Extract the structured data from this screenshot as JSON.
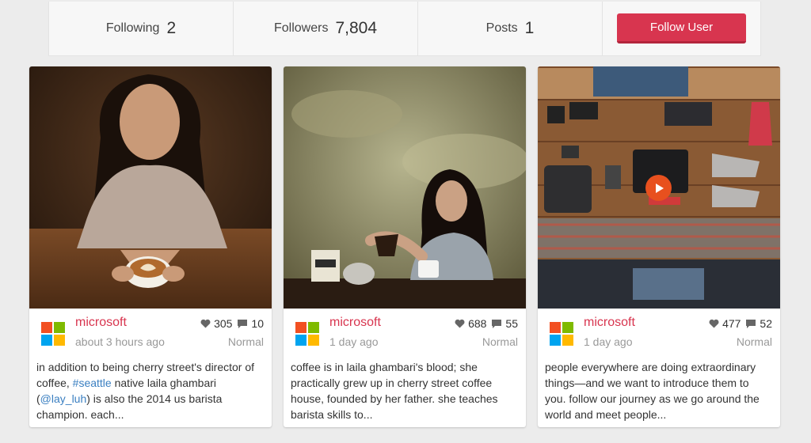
{
  "stats": {
    "following_label": "Following",
    "following_value": "2",
    "followers_label": "Followers",
    "followers_value": "7,804",
    "posts_label": "Posts",
    "posts_value": "1",
    "follow_button": "Follow User"
  },
  "brand_colors": {
    "accent": "#d8354f",
    "link": "#3a7fc1",
    "ms_red": "#f25022",
    "ms_green": "#7fba00",
    "ms_blue": "#00a4ef",
    "ms_yellow": "#ffb900"
  },
  "posts": [
    {
      "author": "microsoft",
      "time": "about 3 hours ago",
      "likes": "305",
      "comments": "10",
      "filter": "Normal",
      "desc_1": "in addition to being cherry street's director of coffee, ",
      "hashtag": "#seattle",
      "desc_2": " native laila ghambari (",
      "mention": "@lay_luh",
      "desc_3": ") is also the 2014 us barista champion. each..."
    },
    {
      "author": "microsoft",
      "time": "1 day ago",
      "likes": "688",
      "comments": "55",
      "filter": "Normal",
      "desc": "coffee is in laila ghambari's blood; she practically grew up in cherry street coffee house, founded by her father. she teaches barista skills to..."
    },
    {
      "author": "microsoft",
      "time": "1 day ago",
      "likes": "477",
      "comments": "52",
      "filter": "Normal",
      "desc": "people everywhere are doing extraordinary things—and we want to introduce them to you. follow our journey as we go around the world and meet people..."
    }
  ],
  "icons": {
    "like": "heart-icon",
    "comment": "comment-icon",
    "video": "play-icon",
    "logo": "microsoft-logo-icon"
  }
}
